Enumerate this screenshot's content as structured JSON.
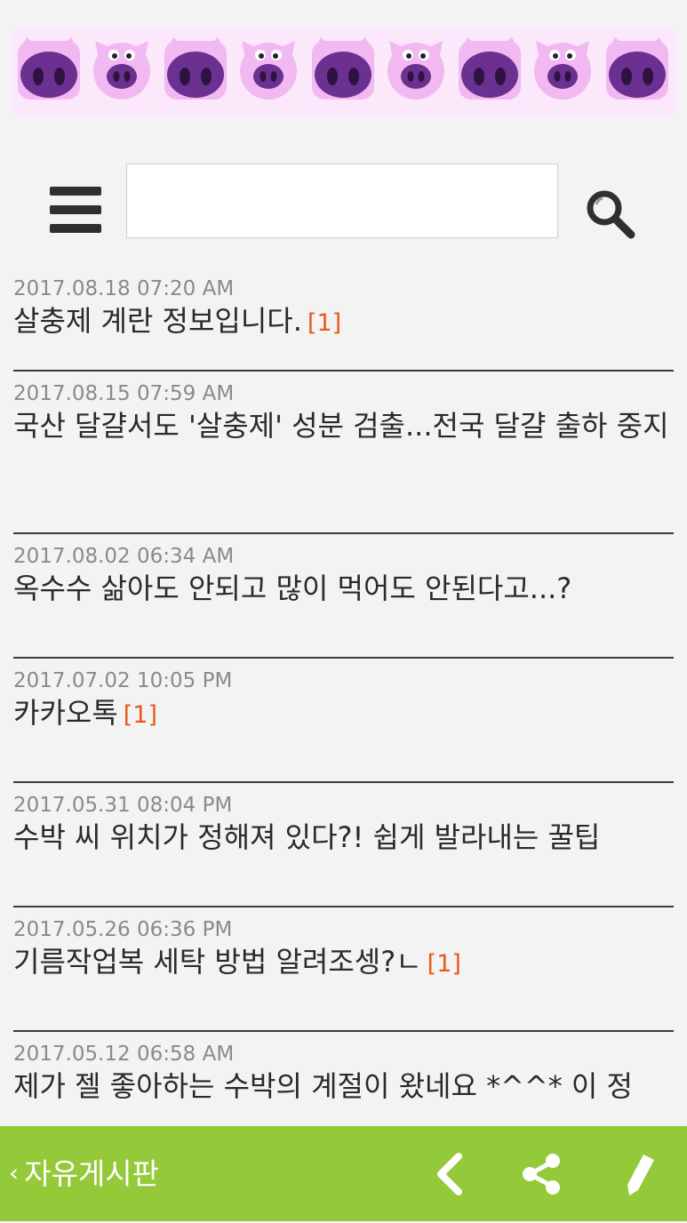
{
  "banner": {
    "pigs": [
      "pig-face-icon",
      "pig-face-icon",
      "pig-face-icon",
      "pig-face-icon",
      "pig-face-icon",
      "pig-face-icon",
      "pig-face-icon",
      "pig-face-icon",
      "pig-face-icon"
    ]
  },
  "toolbar": {
    "menu_icon": "hamburger-menu-icon",
    "search_value": "",
    "search_placeholder": "",
    "search_icon": "magnifier-icon"
  },
  "posts": [
    {
      "date": "2017.08.18 07:20 AM",
      "title": "살충제 계란 정보입니다.",
      "count": "[1]"
    },
    {
      "date": "2017.08.15 07:59 AM",
      "title": "국산 달걀서도 '살충제' 성분 검출...전국 달걀 출하 중지",
      "count": ""
    },
    {
      "date": "2017.08.02 06:34 AM",
      "title": "옥수수 삶아도 안되고 많이 먹어도 안된다고...?",
      "count": ""
    },
    {
      "date": "2017.07.02 10:05 PM",
      "title": "카카오톡",
      "count": "[1]"
    },
    {
      "date": "2017.05.31 08:04 PM",
      "title": "수박 씨 위치가 정해져 있다?! 쉽게 발라내는 꿀팁",
      "count": ""
    },
    {
      "date": "2017.05.26 06:36 PM",
      "title": "기름작업복 세탁 방법 알려조셍?ㄴ",
      "count": "[1]"
    },
    {
      "date": "2017.05.12 06:58 AM",
      "title": "제가 젤 좋아하는 수박의 계절이 왔네요 *^^* 이 정",
      "count": ""
    }
  ],
  "footer": {
    "back_chevron": "‹",
    "board_label": "자유게시판",
    "icons": [
      "back-arrow-icon",
      "share-icon",
      "pencil-icon"
    ]
  },
  "colors": {
    "background": "#f3f3f3",
    "footer_bar": "#94c93a",
    "comment_count": "#e65c1a",
    "banner": "#fbe8fb"
  }
}
